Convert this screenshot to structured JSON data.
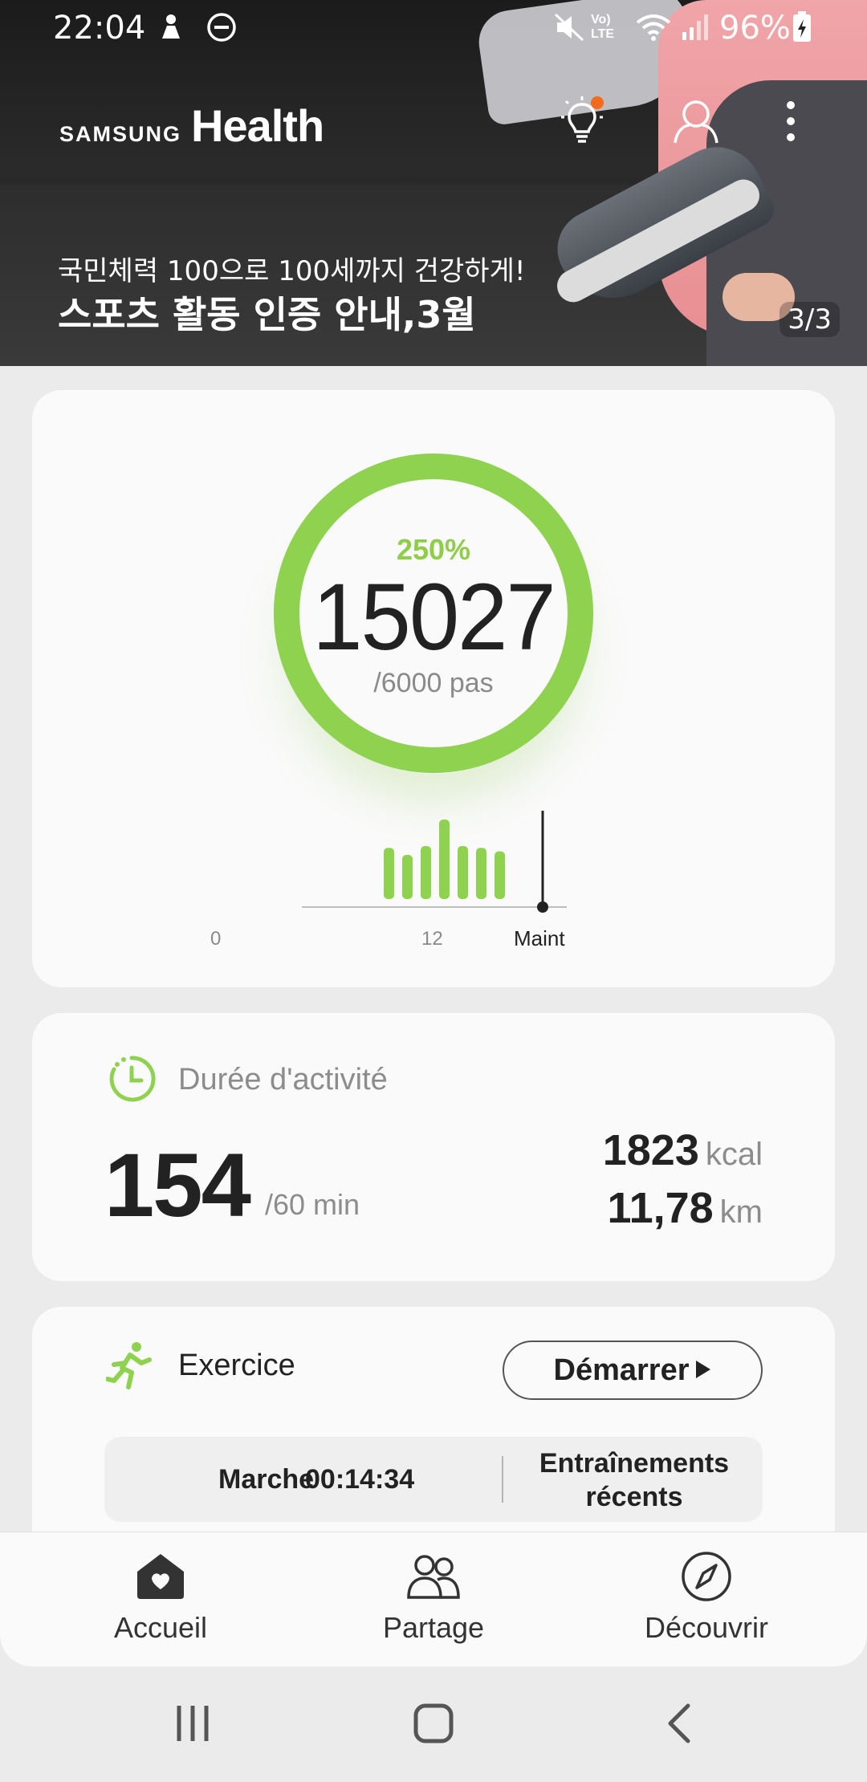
{
  "status_bar": {
    "time": "22:04",
    "battery": "96%"
  },
  "header": {
    "brand_samsung": "SAMSUNG",
    "brand_health": "Health",
    "banner_subtitle": "국민체력 100으로 100세까지 건강하게!",
    "banner_title": "스포츠 활동 인증 안내,3월",
    "banner_page": "3/3"
  },
  "steps": {
    "percent": "250%",
    "count": "15027",
    "goal": "/6000 pas",
    "progress_fraction": 1.0,
    "hourly_bars": [
      0.58,
      0.5,
      0.6,
      0.9,
      0.6,
      0.58,
      0.54
    ],
    "axis": {
      "start": "0",
      "mid": "12",
      "now": "Maint"
    },
    "accent_color": "#8fd24f"
  },
  "activity": {
    "title": "Durée d'activité",
    "value": "154",
    "goal": "/60 min",
    "kcal_value": "1823",
    "kcal_unit": "kcal",
    "distance_value": "11,78",
    "distance_unit": "km"
  },
  "exercise": {
    "title": "Exercice",
    "start_label": "Démarrer",
    "recent_name": "Marche",
    "recent_time": "00:14:34",
    "recent_link": "Entraînements récents"
  },
  "bottom_nav": {
    "home": "Accueil",
    "share": "Partage",
    "discover": "Découvrir"
  }
}
